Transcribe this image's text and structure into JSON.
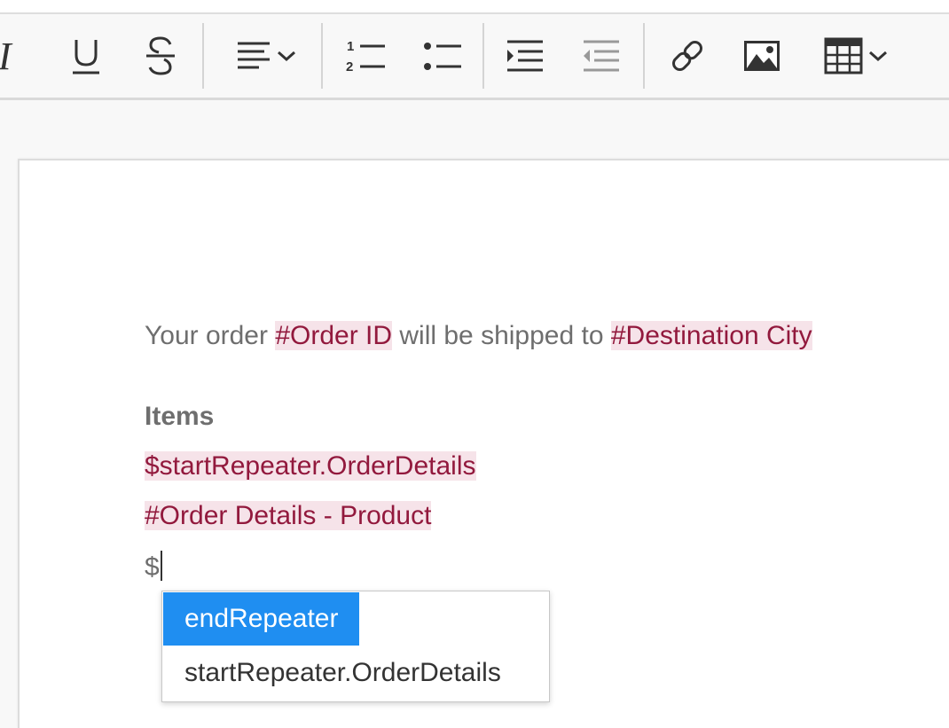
{
  "toolbar": {
    "icons": [
      "italic-icon",
      "underline-icon",
      "strikethrough-icon",
      "align-icon",
      "numbered-list-icon",
      "bulleted-list-icon",
      "indent-icon",
      "outdent-icon",
      "link-icon",
      "image-icon",
      "table-icon"
    ],
    "italic_glyph": "I",
    "underline_glyph": "U",
    "strike_glyph": "S"
  },
  "editor": {
    "line1": {
      "prefix": "Your order ",
      "tag1": "#Order ID",
      "middle": " will be shipped to ",
      "tag2": "#Destination City"
    },
    "heading": "Items",
    "repeater_start": "$startRepeater.OrderDetails",
    "detail_field": "#Order Details - Product",
    "typed": "$"
  },
  "autocomplete": {
    "options": [
      "endRepeater",
      "startRepeater.OrderDetails"
    ],
    "selected_index": 0
  },
  "colors": {
    "tag_bg": "#f6e3e9",
    "tag_text": "#92193d",
    "selection": "#1f8ef1",
    "body_text": "#6e6e6e"
  }
}
